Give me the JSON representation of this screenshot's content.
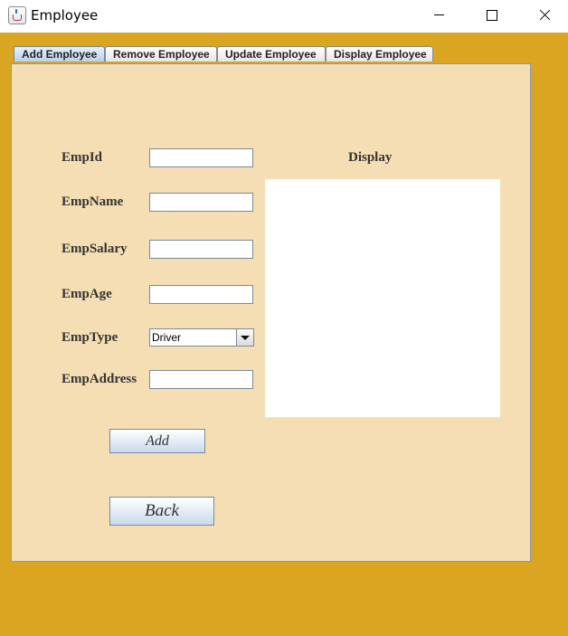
{
  "window": {
    "title": "Employee",
    "controls": [
      "minimize",
      "maximize",
      "close"
    ]
  },
  "tabs": [
    {
      "label": "Add Employee",
      "active": true
    },
    {
      "label": "Remove Employee",
      "active": false
    },
    {
      "label": "Update Employee",
      "active": false
    },
    {
      "label": "Display Employee",
      "active": false
    }
  ],
  "form": {
    "empid_label": "EmpId",
    "empid_value": "",
    "empname_label": "EmpName",
    "empname_value": "",
    "empsalary_label": "EmpSalary",
    "empsalary_value": "",
    "empage_label": "EmpAge",
    "empage_value": "",
    "emptype_label": "EmpType",
    "emptype_selected": "Driver",
    "empaddress_label": "EmpAddress",
    "empaddress_value": ""
  },
  "display": {
    "label": "Display",
    "content": ""
  },
  "buttons": {
    "add": "Add",
    "back": "Back"
  },
  "colors": {
    "window_bg": "#daa520",
    "panel_bg": "#f5deb3",
    "display_bg": "#ffffff"
  }
}
